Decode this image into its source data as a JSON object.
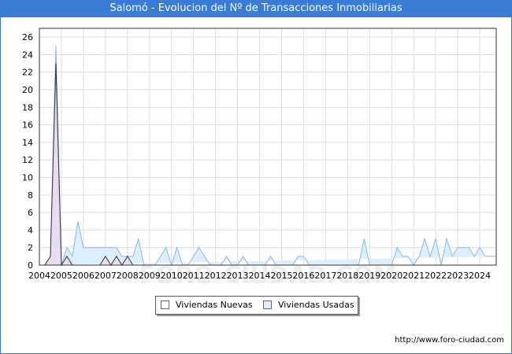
{
  "title": "Salomó - Evolucion del Nº de Transacciones Inmobiliarias",
  "footer_url": "http://www.foro-ciudad.com",
  "watermark": "FORO-CIUDAD.COM",
  "legend": {
    "nuevas_label": "Viviendas Nuevas",
    "usadas_label": "Viviendas Usadas"
  },
  "colors": {
    "title_bg": "#3a7bd5",
    "usadas_fill": "#ddeeff",
    "usadas_line": "#88b8e8",
    "nuevas_fill": "#ffffff",
    "nuevas_line": "#333333",
    "nuevas_peak_fill": "#f0d0e8"
  },
  "chart_data": {
    "type": "area",
    "title": "Salomó - Evolucion del Nº de Transacciones Inmobiliarias",
    "xlabel": "",
    "ylabel": "",
    "xlim": [
      2004,
      2024.75
    ],
    "ylim": [
      0,
      27
    ],
    "y_ticks": [
      0,
      2,
      4,
      6,
      8,
      10,
      12,
      14,
      16,
      18,
      20,
      22,
      24,
      26
    ],
    "x_ticks": [
      "2004",
      "2005",
      "2006",
      "2007",
      "2008",
      "2009",
      "2010",
      "2011",
      "2012",
      "2013",
      "2014",
      "2015",
      "2016",
      "2017",
      "2018",
      "2019",
      "2020",
      "2021",
      "2022",
      "2023",
      "2024"
    ],
    "grid": true,
    "legend_position": "bottom",
    "x_quarters": [
      2004.25,
      2004.5,
      2004.75,
      2005.0,
      2005.25,
      2005.5,
      2005.75,
      2006.0,
      2006.25,
      2006.5,
      2006.75,
      2007.0,
      2007.25,
      2007.5,
      2007.75,
      2008.0,
      2008.25,
      2008.5,
      2008.75,
      2009.0,
      2009.25,
      2009.5,
      2009.75,
      2010.0,
      2010.25,
      2010.5,
      2010.75,
      2011.0,
      2011.25,
      2011.5,
      2011.75,
      2012.0,
      2012.25,
      2012.5,
      2012.75,
      2013.0,
      2013.25,
      2013.5,
      2013.75,
      2014.0,
      2014.25,
      2014.5,
      2014.75,
      2015.0,
      2015.25,
      2015.5,
      2015.75,
      2016.0,
      2016.25,
      2016.5,
      2016.75,
      2017.0,
      2017.25,
      2017.5,
      2017.75,
      2018.0,
      2018.25,
      2018.5,
      2018.75,
      2019.0,
      2019.25,
      2019.5,
      2019.75,
      2020.0,
      2020.25,
      2020.5,
      2020.75,
      2021.0,
      2021.25,
      2021.5,
      2021.75,
      2022.0,
      2022.25,
      2022.5,
      2022.75,
      2023.0,
      2023.25,
      2023.5,
      2023.75,
      2024.0,
      2024.25,
      2024.5,
      2024.75
    ],
    "series": [
      {
        "name": "Viviendas Usadas",
        "values": [
          0,
          1,
          25,
          0,
          2,
          1,
          5,
          2,
          2,
          2,
          2,
          2,
          2,
          2,
          1,
          1,
          1,
          3,
          0,
          0,
          0,
          1,
          2,
          0,
          2,
          0,
          0,
          1,
          2,
          1,
          0,
          0,
          0,
          1,
          0,
          0,
          1,
          0,
          0,
          0,
          0,
          1,
          0,
          0,
          0,
          0,
          1,
          1,
          0,
          0,
          0,
          0,
          0,
          0,
          0,
          0,
          0,
          0,
          3,
          0,
          0,
          0,
          0,
          0,
          2,
          1,
          1,
          0,
          1,
          3,
          1,
          3,
          0,
          3,
          1,
          2,
          2,
          2,
          1,
          2,
          1,
          1,
          1,
          2,
          3
        ]
      },
      {
        "name": "Viviendas Nuevas",
        "values": [
          0,
          1,
          23,
          0,
          1,
          0,
          0,
          0,
          0,
          0,
          0,
          1,
          0,
          1,
          0,
          1,
          0,
          0,
          0,
          0,
          0,
          0,
          0,
          0,
          0,
          0,
          0,
          0,
          0,
          0,
          0,
          0,
          0,
          0,
          0,
          0,
          0,
          0,
          0,
          0,
          0,
          0,
          0,
          0,
          0,
          0,
          0,
          0,
          0,
          0,
          0,
          0,
          0,
          0,
          0,
          0,
          0,
          0,
          0,
          0,
          0,
          0,
          0,
          0,
          0,
          0,
          0,
          0,
          0,
          0,
          0,
          0,
          0,
          0,
          0,
          0,
          0,
          0,
          0,
          0,
          0,
          0,
          0,
          0,
          1
        ]
      }
    ]
  }
}
